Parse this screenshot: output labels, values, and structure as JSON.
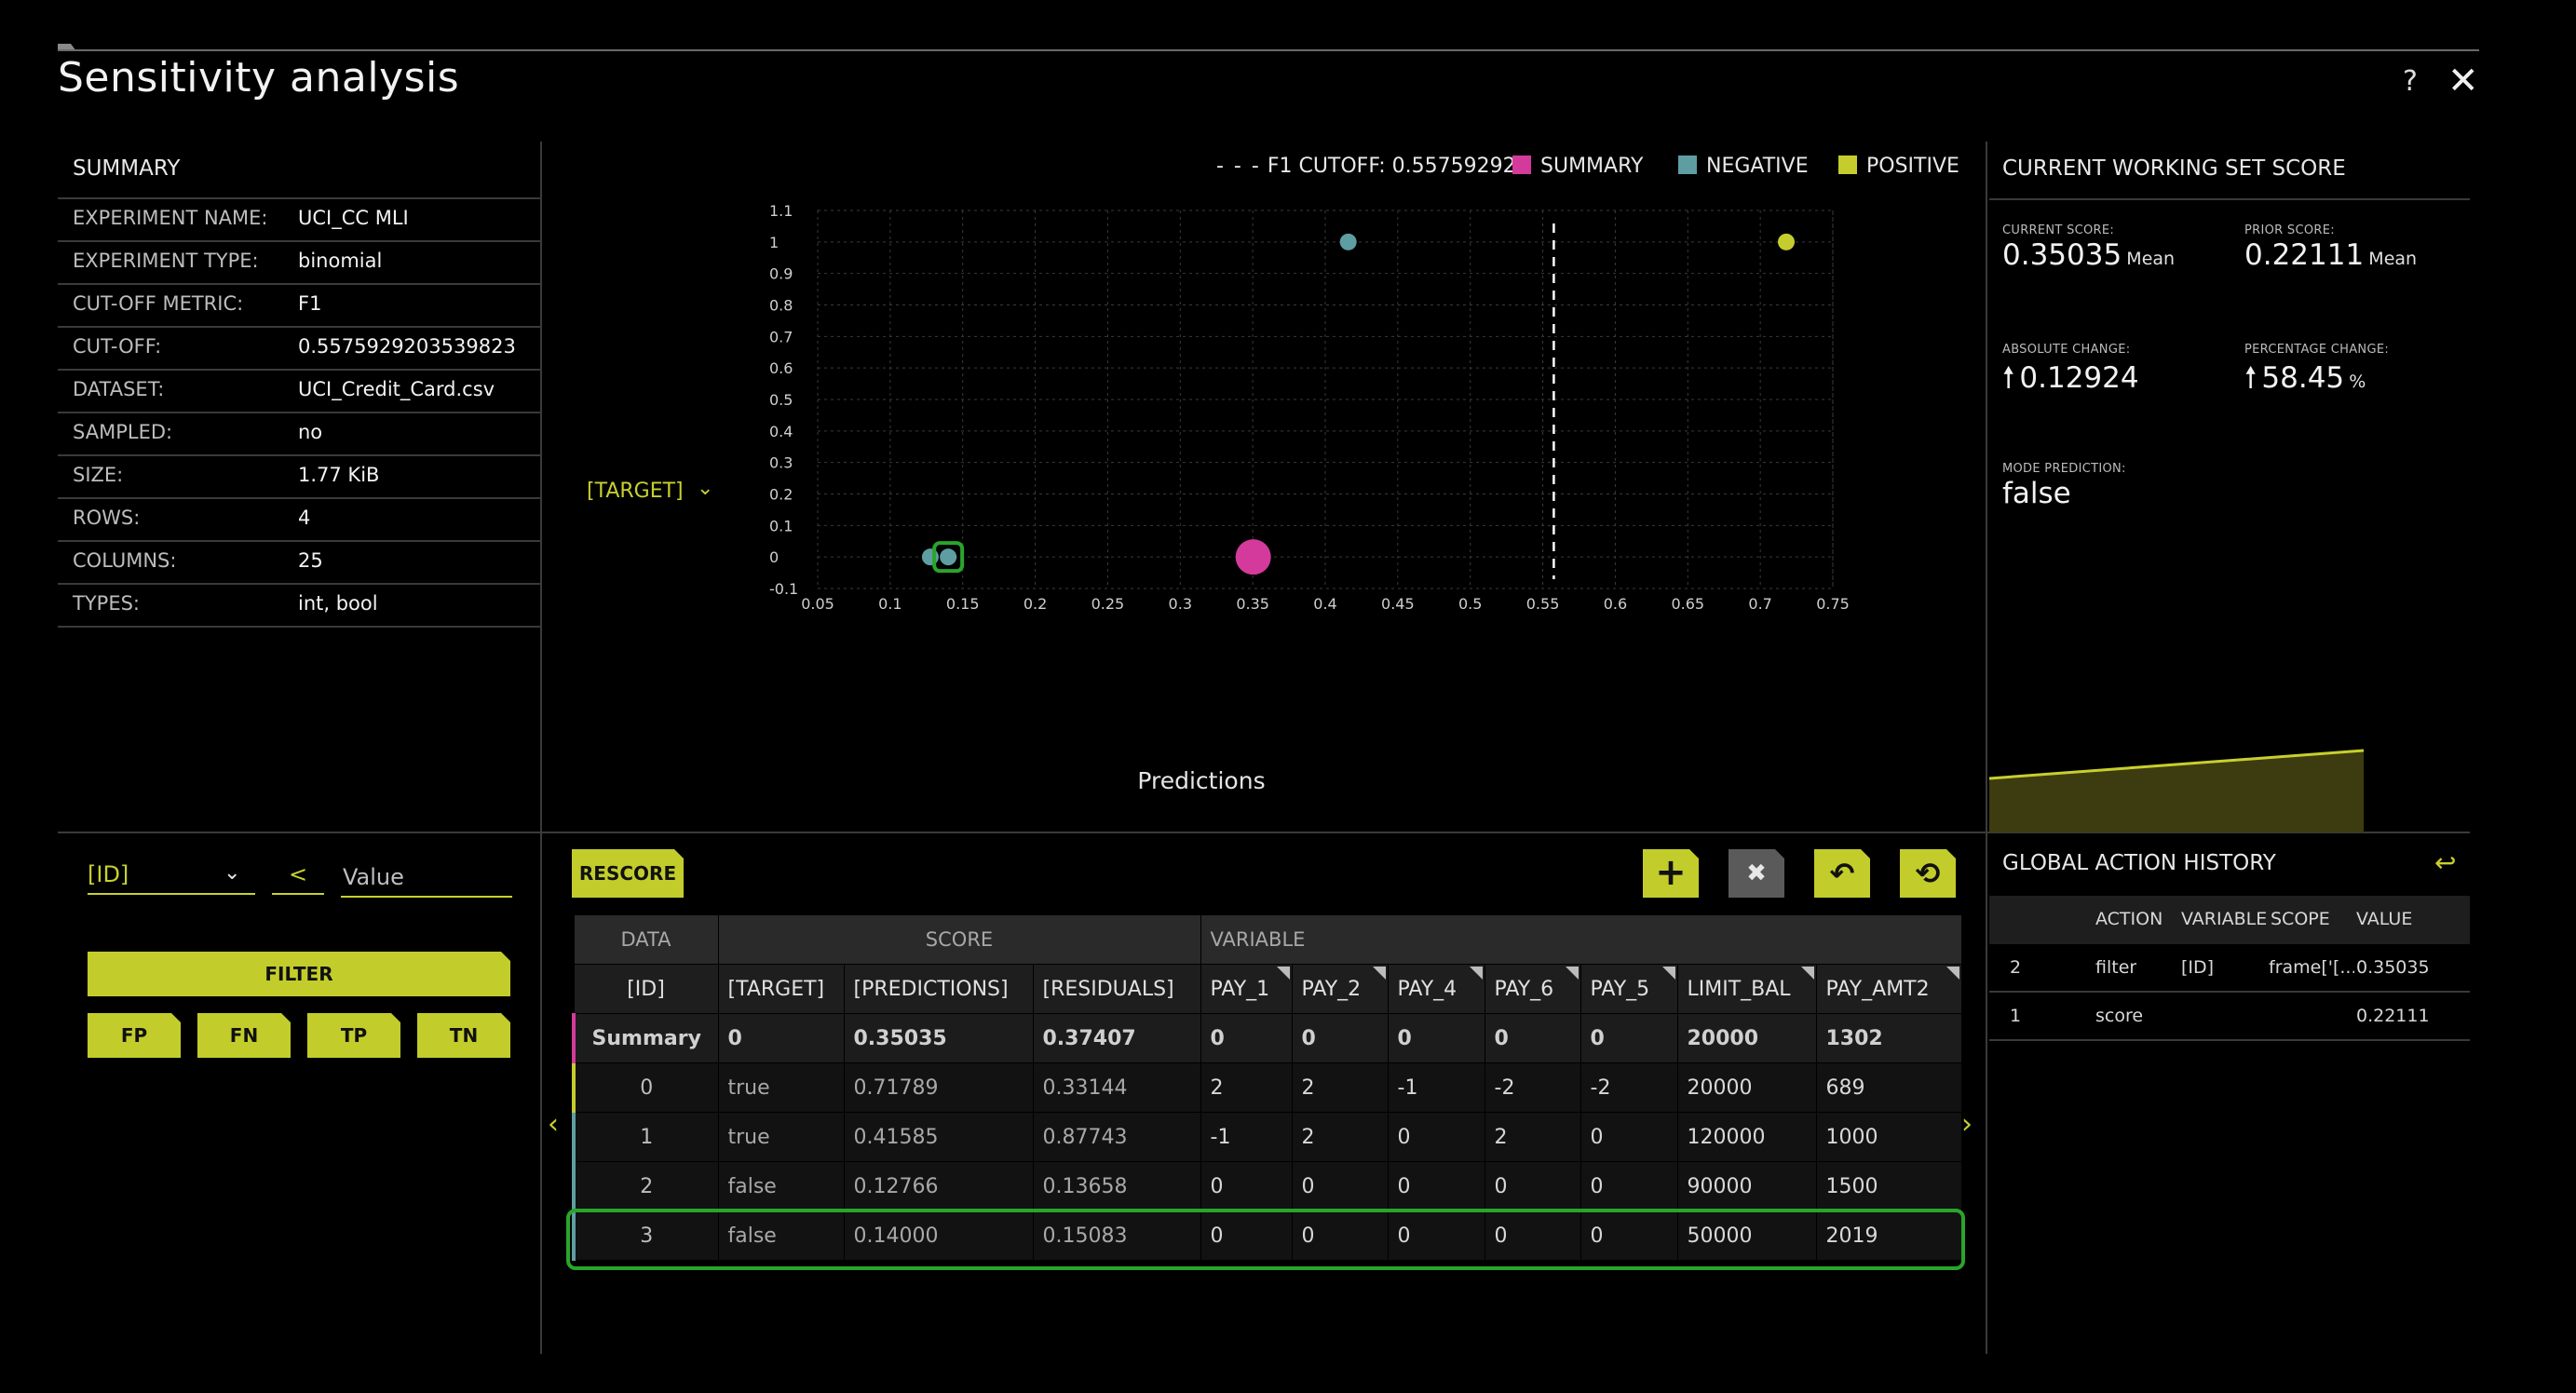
{
  "page": {
    "title": "Sensitivity analysis",
    "help": "?",
    "close": "✕"
  },
  "summary": {
    "title": "SUMMARY",
    "rows": [
      {
        "key": "EXPERIMENT NAME:",
        "value": "UCI_CC MLI"
      },
      {
        "key": "EXPERIMENT TYPE:",
        "value": "binomial"
      },
      {
        "key": "CUT-OFF METRIC:",
        "value": "F1"
      },
      {
        "key": "CUT-OFF:",
        "value": "0.5575929203539823"
      },
      {
        "key": "DATASET:",
        "value": "UCI_Credit_Card.csv"
      },
      {
        "key": "SAMPLED:",
        "value": "no"
      },
      {
        "key": "SIZE:",
        "value": "1.77 KiB"
      },
      {
        "key": "ROWS:",
        "value": "4"
      },
      {
        "key": "COLUMNS:",
        "value": "25"
      },
      {
        "key": "TYPES:",
        "value": "int, bool"
      }
    ]
  },
  "legend": {
    "cutoff": "F1 CUTOFF: 0.55759292",
    "summary": "SUMMARY",
    "negative": "NEGATIVE",
    "positive": "POSITIVE"
  },
  "colors": {
    "summary": "#d43a9c",
    "negative": "#5e9ea3",
    "positive": "#c5cc2e",
    "accent": "#c2cd2b",
    "highlight": "#29a52b"
  },
  "chart_data": {
    "type": "scatter",
    "xlabel": "Predictions",
    "ylabel": "[TARGET]",
    "xlim": [
      0.05,
      0.75
    ],
    "ylim": [
      -0.1,
      1.1
    ],
    "x_ticks": [
      "0.05",
      "0.1",
      "0.15",
      "0.2",
      "0.25",
      "0.3",
      "0.35",
      "0.4",
      "0.45",
      "0.5",
      "0.55",
      "0.6",
      "0.65",
      "0.7",
      "0.75"
    ],
    "y_ticks": [
      "1.1",
      "1",
      "0.9",
      "0.8",
      "0.7",
      "0.6",
      "0.5",
      "0.4",
      "0.3",
      "0.2",
      "0.1",
      "0",
      "-0.1"
    ],
    "cutoff": 0.55759292,
    "grid": true,
    "legend_position": "top-right",
    "series": [
      {
        "name": "SUMMARY",
        "points": [
          {
            "x": 0.35035,
            "y": 0
          }
        ]
      },
      {
        "name": "NEGATIVE",
        "points": [
          {
            "x": 0.41585,
            "y": 1
          },
          {
            "x": 0.12766,
            "y": 0
          },
          {
            "x": 0.14,
            "y": 0
          }
        ]
      },
      {
        "name": "POSITIVE",
        "points": [
          {
            "x": 0.71789,
            "y": 1
          }
        ]
      }
    ]
  },
  "score_panel": {
    "title": "CURRENT WORKING SET SCORE",
    "current_label": "CURRENT SCORE:",
    "current_value": "0.35035",
    "current_unit": "Mean",
    "prior_label": "PRIOR SCORE:",
    "prior_value": "0.22111",
    "prior_unit": "Mean",
    "abs_label": "ABSOLUTE CHANGE:",
    "abs_value": "0.12924",
    "pct_label": "PERCENTAGE CHANGE:",
    "pct_value": "58.45",
    "pct_unit": "%",
    "mode_label": "MODE PREDICTION:",
    "mode_value": "false",
    "arrow": "🠕"
  },
  "filter": {
    "column": "[ID]",
    "operator": "<",
    "value_placeholder": "Value",
    "filter_button": "FILTER",
    "quick": [
      "FP",
      "FN",
      "TP",
      "TN"
    ]
  },
  "toolbar": {
    "rescore": "RESCORE",
    "add": "+",
    "collapse": "✖",
    "undo": "↶",
    "history": "⟲"
  },
  "table": {
    "groups": {
      "data": "DATA",
      "score": "SCORE",
      "variable": "VARIABLE"
    },
    "columns": [
      "[ID]",
      "[TARGET]",
      "[PREDICTIONS]",
      "[RESIDUALS]",
      "PAY_1",
      "PAY_2",
      "PAY_4",
      "PAY_6",
      "PAY_5",
      "LIMIT_BAL",
      "PAY_AMT2"
    ],
    "summary_row": [
      "Summary",
      "0",
      "0.35035",
      "0.37407",
      "0",
      "0",
      "0",
      "0",
      "0",
      "20000",
      "1302"
    ],
    "rows": [
      [
        "0",
        "true",
        "0.71789",
        "0.33144",
        "2",
        "2",
        "-1",
        "-2",
        "-2",
        "20000",
        "689"
      ],
      [
        "1",
        "true",
        "0.41585",
        "0.87743",
        "-1",
        "2",
        "0",
        "2",
        "0",
        "120000",
        "1000"
      ],
      [
        "2",
        "false",
        "0.12766",
        "0.13658",
        "0",
        "0",
        "0",
        "0",
        "0",
        "90000",
        "1500"
      ],
      [
        "3",
        "false",
        "0.14000",
        "0.15083",
        "0",
        "0",
        "0",
        "0",
        "0",
        "50000",
        "2019"
      ]
    ],
    "nav_left": "‹",
    "nav_right": "›"
  },
  "history": {
    "title": "GLOBAL ACTION HISTORY",
    "undo": "↩",
    "headers": [
      "ACTION",
      "VARIABLE",
      "SCOPE",
      "VALUE"
    ],
    "rows": [
      {
        "n": "2",
        "action": "filter",
        "variable": "[ID]",
        "scope": "frame['[...",
        "value": "0.35035"
      },
      {
        "n": "1",
        "action": "score",
        "variable": "",
        "scope": "",
        "value": "0.22111"
      }
    ]
  }
}
